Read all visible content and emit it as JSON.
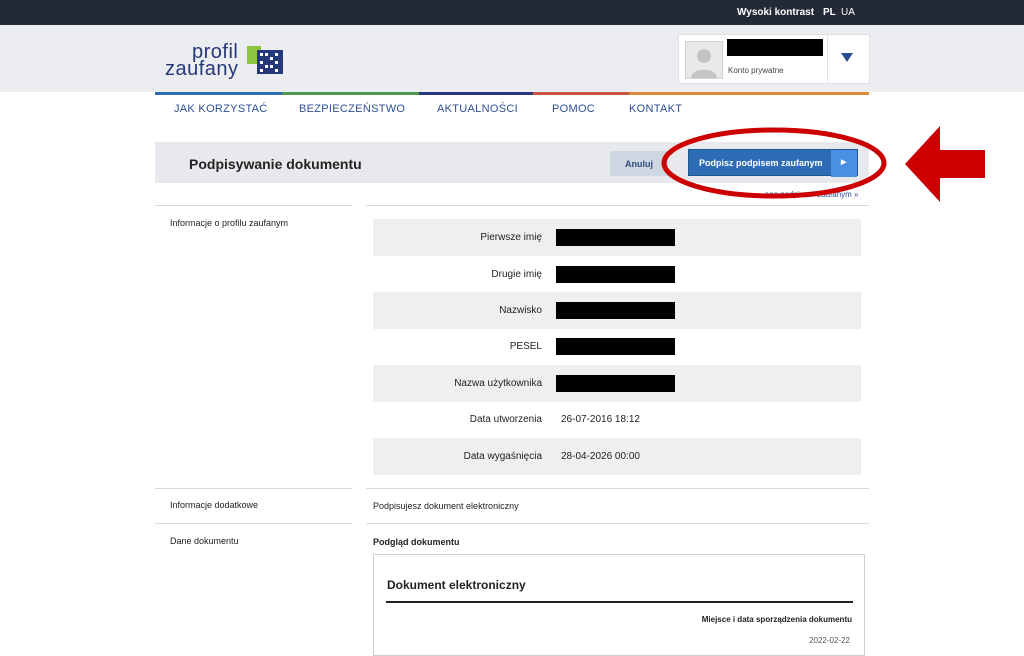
{
  "topbar": {
    "contrast": "Wysoki kontrast",
    "lang_pl": "PL",
    "lang_ua": "UA"
  },
  "logo": {
    "line1": "profil",
    "line2": "zaufany"
  },
  "user": {
    "account_type": "Konto prywatne"
  },
  "nav": {
    "items": [
      {
        "label": "JAK KORZYSTAĆ",
        "color": "#2e6db6"
      },
      {
        "label": "BEZPIECZEŃSTWO",
        "color": "#4b9a50"
      },
      {
        "label": "AKTUALNOŚCI",
        "color": "#26387a"
      },
      {
        "label": "POMOC",
        "color": "#c8553d"
      },
      {
        "label": "KONTAKT",
        "color": "#d98a3a"
      }
    ]
  },
  "page": {
    "title": "Podpisywanie dokumentu",
    "cancel_label": "Anuluj",
    "sign_label": "Podpisz podpisem zaufanym",
    "sublink": "...ego podpisem zaufanym »"
  },
  "sections": {
    "profile": "Informacje o profilu zaufanym",
    "additional": "Informacje dodatkowe",
    "document": "Dane dokumentu"
  },
  "profile_rows": [
    {
      "label": "Pierwsze imię",
      "value": ""
    },
    {
      "label": "Drugie imię",
      "value": ""
    },
    {
      "label": "Nazwisko",
      "value": ""
    },
    {
      "label": "PESEL",
      "value": ""
    },
    {
      "label": "Nazwa użytkownika",
      "value": ""
    },
    {
      "label": "Data utworzenia",
      "value": "26-07-2016 18:12"
    },
    {
      "label": "Data wygaśnięcia",
      "value": "28-04-2026 00:00"
    }
  ],
  "additional_text": "Podpisujesz dokument elektroniczny",
  "preview": {
    "heading": "Podgląd dokumentu",
    "doc_title": "Dokument elektroniczny",
    "meta_label": "Miejsce i data sporządzenia dokumentu",
    "date_partial": "2022-02-22"
  },
  "colors": {
    "accent": "#2e6db6",
    "annotation_red": "#cc0000",
    "header_bg": "#ebedf0"
  }
}
